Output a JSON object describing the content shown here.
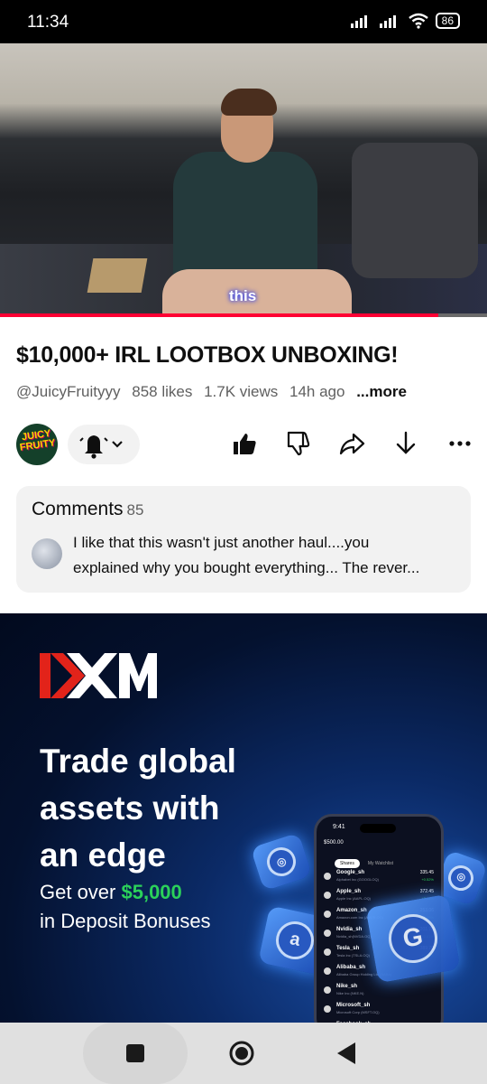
{
  "status_bar": {
    "time": "11:34",
    "battery": "86"
  },
  "video": {
    "caption": "this",
    "progress_fraction": 0.9
  },
  "details": {
    "title": "$10,000+ IRL LOOTBOX UNBOXING!",
    "channel": "@JuicyFruityyy",
    "likes": "858 likes",
    "views": "1.7K views",
    "age": "14h ago",
    "more": "...more",
    "avatar_text": "JUICY FRUITY"
  },
  "actions": [
    "bell-icon",
    "like-icon",
    "dislike-icon",
    "share-icon",
    "download-icon",
    "more-icon"
  ],
  "comments": {
    "label": "Comments",
    "count": "85",
    "line1": "I like that this wasn't just another haul....you",
    "line2": "explained why you bought everything... The rever..."
  },
  "ad": {
    "brand": "XM",
    "headline_1": "Trade global",
    "headline_2": "assets with",
    "headline_3": "an edge",
    "sub_1": "Get over ",
    "sub_amount": "$5,000",
    "sub_2": "in Deposit Bonuses",
    "brand_color": "#e2231a",
    "accent_green": "#2bd15a",
    "phone": {
      "time": "9:41",
      "balance": "$500.00",
      "tabs": [
        "Shares",
        "My Watchlist"
      ],
      "rows": [
        {
          "name": "Google_sh",
          "sub": "Alphabet Inc (GOOGLOQ)",
          "price": "335.45",
          "change": "+0.52%"
        },
        {
          "name": "Apple_sh",
          "sub": "Apple Inc (AAPL.OQ)",
          "price": "372.45",
          "change": "+2.44%"
        },
        {
          "name": "Amazon_sh",
          "sub": "Amazon.com Inc (AMZN.OQ)",
          "price": "253.06",
          "change": "+1.26%"
        },
        {
          "name": "Nvidia_sh",
          "sub": "Nvidia_sh(NVDA.OQ)",
          "price": "201.70",
          "change": "+2.81%"
        },
        {
          "name": "Tesla_sh",
          "sub": "Tesla Inc (TSLA.OQ)",
          "price": "389.70",
          "change": "+5.84%"
        },
        {
          "name": "Alibaba_sh",
          "sub": "Alibaba Group Holding Ltd (BABA)",
          "price": "",
          "change": ""
        },
        {
          "name": "Nike_sh",
          "sub": "Nike Inc (NKE.N)",
          "price": "",
          "change": ""
        },
        {
          "name": "Microsoft_sh",
          "sub": "Microsoft Corp (MSFT.OQ)",
          "price": "",
          "change": ""
        },
        {
          "name": "Facebook_sh",
          "sub": "",
          "price": "",
          "change": ""
        }
      ]
    }
  }
}
